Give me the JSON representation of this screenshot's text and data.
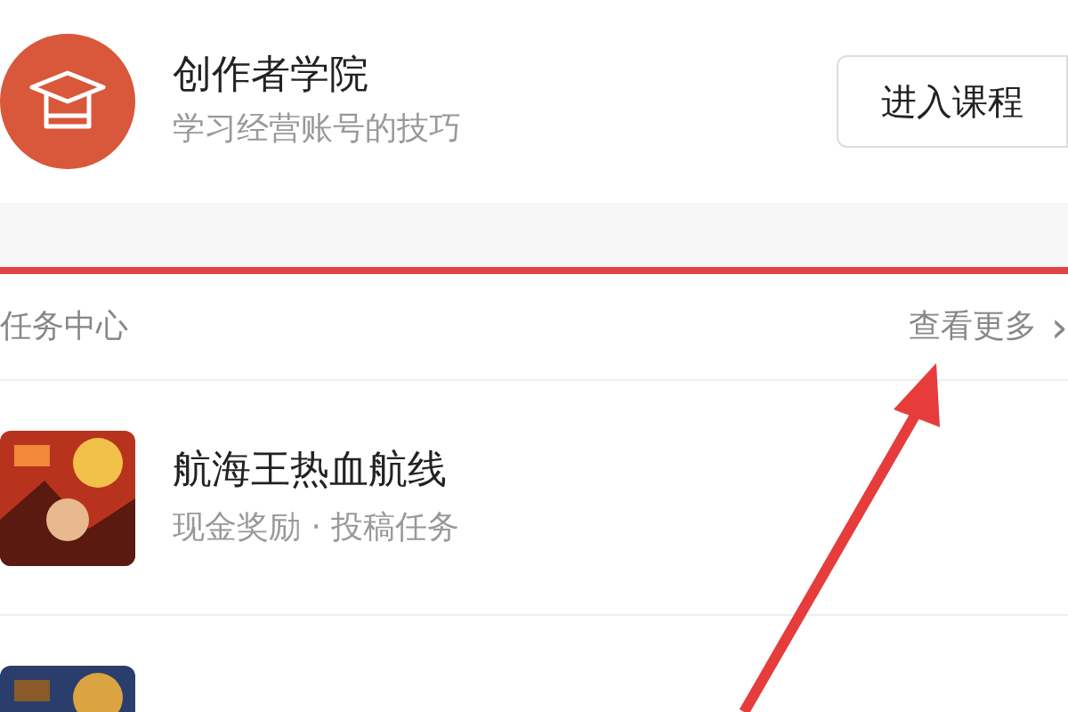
{
  "academy": {
    "title": "创作者学院",
    "subtitle": "学习经营账号的技巧",
    "button": "进入课程"
  },
  "task_center": {
    "title": "任务中心",
    "more": "查看更多",
    "more_icon": "›",
    "items": [
      {
        "title": "航海王热血航线",
        "subtitle": "现金奖励 · 投稿任务",
        "kind": "picture"
      },
      {
        "kind": "picture"
      }
    ]
  }
}
